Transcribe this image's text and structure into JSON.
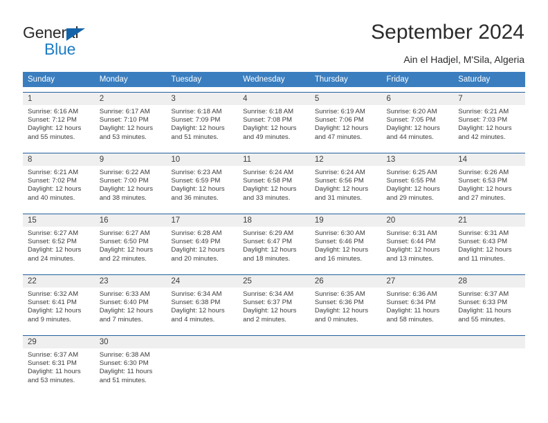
{
  "brand": {
    "name_dark": "General",
    "name_blue": "Blue",
    "accent_blue": "#1d7cc4",
    "triangle_blue": "#1464aa"
  },
  "header": {
    "title": "September 2024",
    "location": "Ain el Hadjel, M'Sila, Algeria"
  },
  "calendar": {
    "header_bg": "#3a7ebf",
    "daynum_bg": "#efefef",
    "separator": "#215e9e",
    "weekdays": [
      "Sunday",
      "Monday",
      "Tuesday",
      "Wednesday",
      "Thursday",
      "Friday",
      "Saturday"
    ],
    "weeks": [
      [
        {
          "day": "1",
          "sunrise": "Sunrise: 6:16 AM",
          "sunset": "Sunset: 7:12 PM",
          "daylight1": "Daylight: 12 hours",
          "daylight2": "and 55 minutes."
        },
        {
          "day": "2",
          "sunrise": "Sunrise: 6:17 AM",
          "sunset": "Sunset: 7:10 PM",
          "daylight1": "Daylight: 12 hours",
          "daylight2": "and 53 minutes."
        },
        {
          "day": "3",
          "sunrise": "Sunrise: 6:18 AM",
          "sunset": "Sunset: 7:09 PM",
          "daylight1": "Daylight: 12 hours",
          "daylight2": "and 51 minutes."
        },
        {
          "day": "4",
          "sunrise": "Sunrise: 6:18 AM",
          "sunset": "Sunset: 7:08 PM",
          "daylight1": "Daylight: 12 hours",
          "daylight2": "and 49 minutes."
        },
        {
          "day": "5",
          "sunrise": "Sunrise: 6:19 AM",
          "sunset": "Sunset: 7:06 PM",
          "daylight1": "Daylight: 12 hours",
          "daylight2": "and 47 minutes."
        },
        {
          "day": "6",
          "sunrise": "Sunrise: 6:20 AM",
          "sunset": "Sunset: 7:05 PM",
          "daylight1": "Daylight: 12 hours",
          "daylight2": "and 44 minutes."
        },
        {
          "day": "7",
          "sunrise": "Sunrise: 6:21 AM",
          "sunset": "Sunset: 7:03 PM",
          "daylight1": "Daylight: 12 hours",
          "daylight2": "and 42 minutes."
        }
      ],
      [
        {
          "day": "8",
          "sunrise": "Sunrise: 6:21 AM",
          "sunset": "Sunset: 7:02 PM",
          "daylight1": "Daylight: 12 hours",
          "daylight2": "and 40 minutes."
        },
        {
          "day": "9",
          "sunrise": "Sunrise: 6:22 AM",
          "sunset": "Sunset: 7:00 PM",
          "daylight1": "Daylight: 12 hours",
          "daylight2": "and 38 minutes."
        },
        {
          "day": "10",
          "sunrise": "Sunrise: 6:23 AM",
          "sunset": "Sunset: 6:59 PM",
          "daylight1": "Daylight: 12 hours",
          "daylight2": "and 36 minutes."
        },
        {
          "day": "11",
          "sunrise": "Sunrise: 6:24 AM",
          "sunset": "Sunset: 6:58 PM",
          "daylight1": "Daylight: 12 hours",
          "daylight2": "and 33 minutes."
        },
        {
          "day": "12",
          "sunrise": "Sunrise: 6:24 AM",
          "sunset": "Sunset: 6:56 PM",
          "daylight1": "Daylight: 12 hours",
          "daylight2": "and 31 minutes."
        },
        {
          "day": "13",
          "sunrise": "Sunrise: 6:25 AM",
          "sunset": "Sunset: 6:55 PM",
          "daylight1": "Daylight: 12 hours",
          "daylight2": "and 29 minutes."
        },
        {
          "day": "14",
          "sunrise": "Sunrise: 6:26 AM",
          "sunset": "Sunset: 6:53 PM",
          "daylight1": "Daylight: 12 hours",
          "daylight2": "and 27 minutes."
        }
      ],
      [
        {
          "day": "15",
          "sunrise": "Sunrise: 6:27 AM",
          "sunset": "Sunset: 6:52 PM",
          "daylight1": "Daylight: 12 hours",
          "daylight2": "and 24 minutes."
        },
        {
          "day": "16",
          "sunrise": "Sunrise: 6:27 AM",
          "sunset": "Sunset: 6:50 PM",
          "daylight1": "Daylight: 12 hours",
          "daylight2": "and 22 minutes."
        },
        {
          "day": "17",
          "sunrise": "Sunrise: 6:28 AM",
          "sunset": "Sunset: 6:49 PM",
          "daylight1": "Daylight: 12 hours",
          "daylight2": "and 20 minutes."
        },
        {
          "day": "18",
          "sunrise": "Sunrise: 6:29 AM",
          "sunset": "Sunset: 6:47 PM",
          "daylight1": "Daylight: 12 hours",
          "daylight2": "and 18 minutes."
        },
        {
          "day": "19",
          "sunrise": "Sunrise: 6:30 AM",
          "sunset": "Sunset: 6:46 PM",
          "daylight1": "Daylight: 12 hours",
          "daylight2": "and 16 minutes."
        },
        {
          "day": "20",
          "sunrise": "Sunrise: 6:31 AM",
          "sunset": "Sunset: 6:44 PM",
          "daylight1": "Daylight: 12 hours",
          "daylight2": "and 13 minutes."
        },
        {
          "day": "21",
          "sunrise": "Sunrise: 6:31 AM",
          "sunset": "Sunset: 6:43 PM",
          "daylight1": "Daylight: 12 hours",
          "daylight2": "and 11 minutes."
        }
      ],
      [
        {
          "day": "22",
          "sunrise": "Sunrise: 6:32 AM",
          "sunset": "Sunset: 6:41 PM",
          "daylight1": "Daylight: 12 hours",
          "daylight2": "and 9 minutes."
        },
        {
          "day": "23",
          "sunrise": "Sunrise: 6:33 AM",
          "sunset": "Sunset: 6:40 PM",
          "daylight1": "Daylight: 12 hours",
          "daylight2": "and 7 minutes."
        },
        {
          "day": "24",
          "sunrise": "Sunrise: 6:34 AM",
          "sunset": "Sunset: 6:38 PM",
          "daylight1": "Daylight: 12 hours",
          "daylight2": "and 4 minutes."
        },
        {
          "day": "25",
          "sunrise": "Sunrise: 6:34 AM",
          "sunset": "Sunset: 6:37 PM",
          "daylight1": "Daylight: 12 hours",
          "daylight2": "and 2 minutes."
        },
        {
          "day": "26",
          "sunrise": "Sunrise: 6:35 AM",
          "sunset": "Sunset: 6:36 PM",
          "daylight1": "Daylight: 12 hours",
          "daylight2": "and 0 minutes."
        },
        {
          "day": "27",
          "sunrise": "Sunrise: 6:36 AM",
          "sunset": "Sunset: 6:34 PM",
          "daylight1": "Daylight: 11 hours",
          "daylight2": "and 58 minutes."
        },
        {
          "day": "28",
          "sunrise": "Sunrise: 6:37 AM",
          "sunset": "Sunset: 6:33 PM",
          "daylight1": "Daylight: 11 hours",
          "daylight2": "and 55 minutes."
        }
      ],
      [
        {
          "day": "29",
          "sunrise": "Sunrise: 6:37 AM",
          "sunset": "Sunset: 6:31 PM",
          "daylight1": "Daylight: 11 hours",
          "daylight2": "and 53 minutes."
        },
        {
          "day": "30",
          "sunrise": "Sunrise: 6:38 AM",
          "sunset": "Sunset: 6:30 PM",
          "daylight1": "Daylight: 11 hours",
          "daylight2": "and 51 minutes."
        },
        {
          "day": "",
          "sunrise": "",
          "sunset": "",
          "daylight1": "",
          "daylight2": ""
        },
        {
          "day": "",
          "sunrise": "",
          "sunset": "",
          "daylight1": "",
          "daylight2": ""
        },
        {
          "day": "",
          "sunrise": "",
          "sunset": "",
          "daylight1": "",
          "daylight2": ""
        },
        {
          "day": "",
          "sunrise": "",
          "sunset": "",
          "daylight1": "",
          "daylight2": ""
        },
        {
          "day": "",
          "sunrise": "",
          "sunset": "",
          "daylight1": "",
          "daylight2": ""
        }
      ]
    ]
  }
}
